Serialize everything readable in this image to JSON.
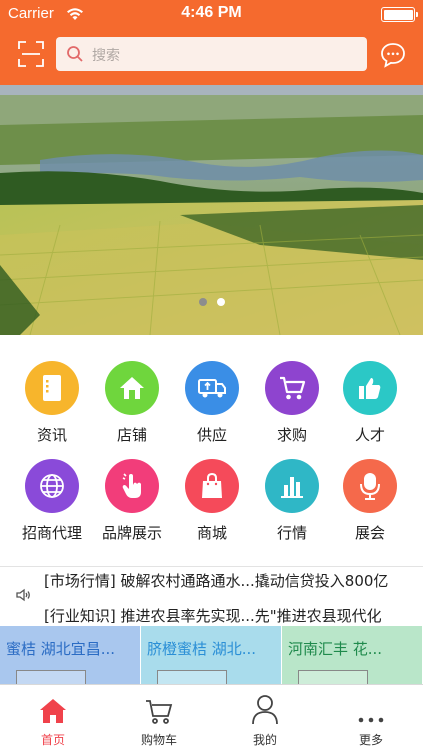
{
  "status_bar": {
    "carrier": "Carrier",
    "time": "4:46 PM"
  },
  "header": {
    "search_placeholder": "搜索"
  },
  "banner": {
    "slide_count": 2,
    "active_slide": 2
  },
  "categories": [
    {
      "label": "资讯",
      "icon": "document-icon",
      "color": "#f7b52c"
    },
    {
      "label": "店铺",
      "icon": "house-icon",
      "color": "#6fd63d"
    },
    {
      "label": "供应",
      "icon": "truck-icon",
      "color": "#3a8ee6"
    },
    {
      "label": "求购",
      "icon": "cart-icon",
      "color": "#8e44cf"
    },
    {
      "label": "人才",
      "icon": "thumbs-up-icon",
      "color": "#2bc8c6"
    },
    {
      "label": "招商代理",
      "icon": "globe-icon",
      "color": "#8a4ad9"
    },
    {
      "label": "品牌展示",
      "icon": "tap-hand-icon",
      "color": "#f23d7a"
    },
    {
      "label": "商城",
      "icon": "shopping-bag-icon",
      "color": "#f54a5a"
    },
    {
      "label": "行情",
      "icon": "bar-chart-icon",
      "color": "#2fb7c6"
    },
    {
      "label": "展会",
      "icon": "microphone-icon",
      "color": "#f5694b"
    }
  ],
  "news": {
    "lines": [
      "[市场行情]  破解农村通路通水...撬动信贷投入800亿",
      "[行业知识]  推进农县率先实现...先\"推进农县现代化"
    ]
  },
  "promos": [
    {
      "title": "蜜桔 湖北宜昌...",
      "bg": "#a9c7ee",
      "color": "#2b6cc4"
    },
    {
      "title": "脐橙蜜桔 湖北...",
      "bg": "#a9dcec",
      "color": "#2b8fd6"
    },
    {
      "title": "河南汇丰  花...",
      "bg": "#b9e6c9",
      "color": "#1f8a4c"
    }
  ],
  "tabbar": {
    "accent": "#f0424b",
    "items": [
      {
        "label": "首页",
        "icon": "home-icon"
      },
      {
        "label": "购物车",
        "icon": "cart-icon"
      },
      {
        "label": "我的",
        "icon": "person-icon"
      },
      {
        "label": "更多",
        "icon": "more-icon"
      }
    ]
  },
  "colors": {
    "header": "#f56a2e"
  }
}
